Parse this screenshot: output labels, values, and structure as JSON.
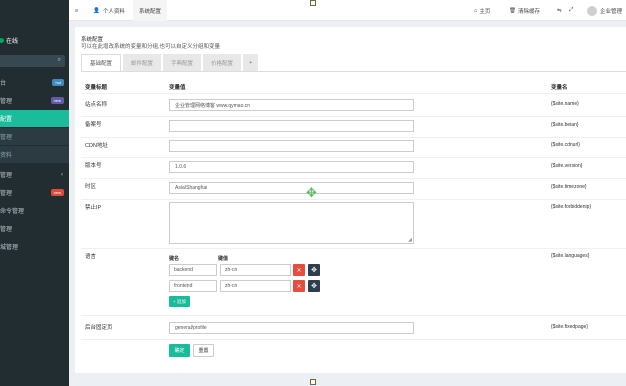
{
  "sidebar": {
    "status": "在线",
    "items": [
      {
        "label": "台",
        "badge": "hot",
        "badge_color": "#3c8dbc"
      },
      {
        "label": "管理",
        "badge": "new",
        "badge_color": "#605ca8"
      },
      {
        "label": "配置",
        "active": true
      },
      {
        "label": "管理",
        "sub": true
      },
      {
        "label": "资料",
        "sub": true
      },
      {
        "label": "管理",
        "chevron": "‹"
      },
      {
        "label": "管理",
        "badge": "new",
        "badge_color": "#dd4b39"
      },
      {
        "label": "命令管理"
      },
      {
        "label": "管理"
      },
      {
        "label": "城管理"
      }
    ]
  },
  "topbar": {
    "menu_icon": "≡",
    "tab_profile": "个人资料",
    "tab_sysconfig": "系统配置",
    "home": "主页",
    "clear_cache": "清除缓存",
    "user": "企业管理"
  },
  "page": {
    "title": "系统配置",
    "description": "可以在此增改系统的变量和分组,也可以自定义分组和变量"
  },
  "tabs": [
    "基础配置",
    "邮件配置",
    "字典配置",
    "价格配置",
    "+"
  ],
  "table": {
    "headers": {
      "title": "变量标题",
      "value": "变量值",
      "name": "变量名"
    }
  },
  "fields": {
    "site_name": {
      "label": "站点名称",
      "value": "企业管理网络博客 www.qymao.cn",
      "var": "{$site.name}"
    },
    "beian": {
      "label": "备案号",
      "value": "",
      "var": "{$site.beian}"
    },
    "cdnurl": {
      "label": "CDN地址",
      "value": "",
      "var": "{$site.cdnurl}"
    },
    "version": {
      "label": "版本号",
      "value": "1.0.6",
      "var": "{$site.version}"
    },
    "timezone": {
      "label": "时区",
      "value": "Asia/Shanghai",
      "var": "{$site.timezone}"
    },
    "forbiddenip": {
      "label": "禁止IP",
      "value": "",
      "var": "{$site.forbiddenip}"
    },
    "languages": {
      "label": "语言",
      "key_header": "键名",
      "value_header": "键值",
      "rows": [
        {
          "key": "backend",
          "value": "zh-cn"
        },
        {
          "key": "frontend",
          "value": "zh-cn"
        }
      ],
      "add_label": "+ 追加",
      "var": "{$site.languages}"
    },
    "fixedpage": {
      "label": "后台固定页",
      "value": "general/profile",
      "var": "{$site.fixedpage}"
    }
  },
  "buttons": {
    "submit": "确定",
    "reset": "重置"
  },
  "icons": {
    "remove": "✕",
    "move": "✥"
  }
}
